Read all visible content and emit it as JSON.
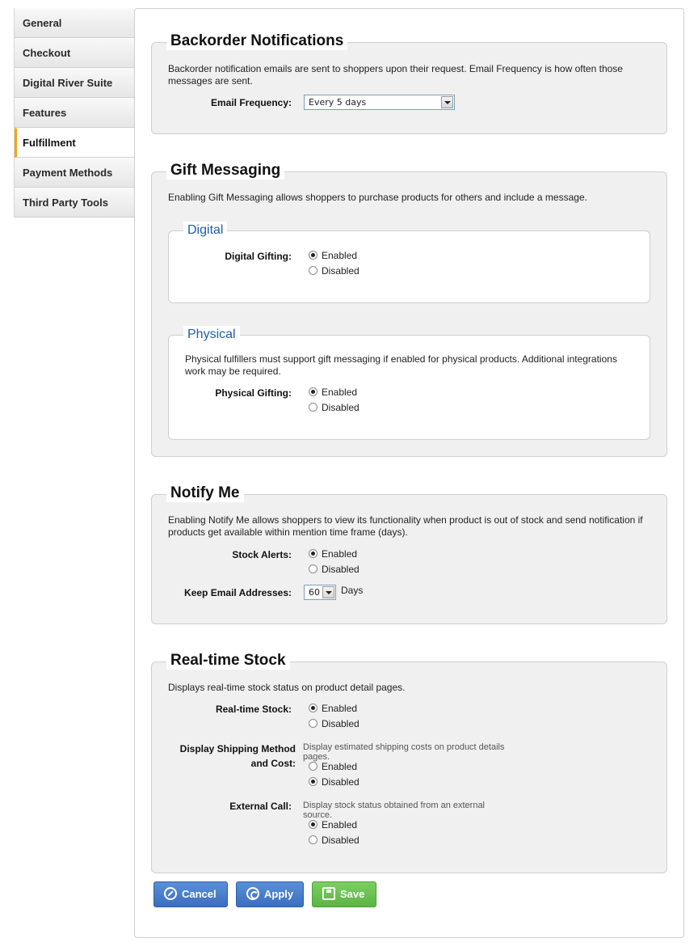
{
  "sidebar": {
    "items": [
      {
        "label": "General"
      },
      {
        "label": "Checkout"
      },
      {
        "label": "Digital River Suite"
      },
      {
        "label": "Features"
      },
      {
        "label": "Fulfillment"
      },
      {
        "label": "Payment Methods"
      },
      {
        "label": "Third Party Tools"
      }
    ],
    "active": "Fulfillment",
    "accent_color": "#f3a31a"
  },
  "backorder": {
    "title": "Backorder Notifications",
    "description": "Backorder notification emails are sent to shoppers upon their request. Email Frequency is how often those messages are sent.",
    "email_frequency_label": "Email Frequency:",
    "email_frequency_value": "Every 5 days"
  },
  "gift": {
    "title": "Gift Messaging",
    "description": "Enabling Gift Messaging allows shoppers to purchase products for others and include a message.",
    "digital": {
      "title": "Digital",
      "label": "Digital Gifting:",
      "enabled": "Enabled",
      "disabled": "Disabled",
      "selected": "Enabled"
    },
    "physical": {
      "title": "Physical",
      "description": "Physical fulfillers must support gift messaging if enabled for physical products. Additional integrations work may be required.",
      "label": "Physical Gifting:",
      "enabled": "Enabled",
      "disabled": "Disabled",
      "selected": "Enabled"
    }
  },
  "notify": {
    "title": "Notify Me",
    "description": "Enabling Notify Me allows shoppers to view its functionality when product is out of stock and send notification if products get available within mention time frame (days).",
    "stock_alerts_label": "Stock Alerts:",
    "enabled": "Enabled",
    "disabled": "Disabled",
    "stock_alerts_selected": "Enabled",
    "keep_email_label": "Keep Email Addresses:",
    "keep_email_value": "60",
    "days_label": "Days"
  },
  "realtime": {
    "title": "Real-time Stock",
    "description": "Displays real-time stock status on product detail pages.",
    "stock_label": "Real-time Stock:",
    "stock_selected": "Enabled",
    "shipping_label": "Display Shipping Method and Cost:",
    "shipping_hint": "Display estimated shipping costs on product details pages.",
    "shipping_selected": "Disabled",
    "external_label": "External Call:",
    "external_hint": "Display stock status obtained from an external source.",
    "external_selected": "Enabled",
    "enabled": "Enabled",
    "disabled": "Disabled"
  },
  "buttons": {
    "cancel": "Cancel",
    "apply": "Apply",
    "save": "Save"
  },
  "colors": {
    "primary_button": "#3b6fbf",
    "save_button": "#5bb443",
    "inner_legend": "#1d5fa8"
  }
}
